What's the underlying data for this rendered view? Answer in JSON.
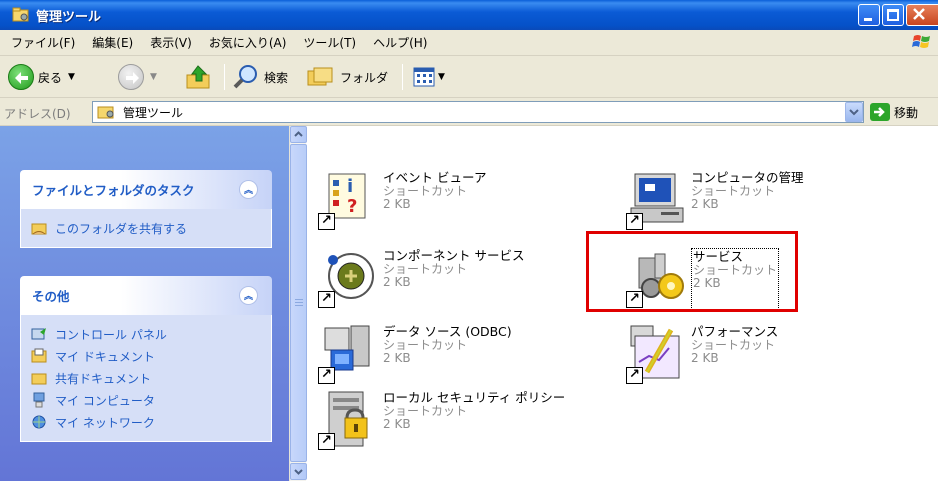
{
  "window": {
    "title": "管理ツール"
  },
  "menu": [
    "ファイル(F)",
    "編集(E)",
    "表示(V)",
    "お気に入り(A)",
    "ツール(T)",
    "ヘルプ(H)"
  ],
  "toolbar": {
    "back_label": "戻る",
    "search_label": "検索",
    "folders_label": "フォルダ"
  },
  "address": {
    "label": "アドレス(D)",
    "value": "管理ツール",
    "go_label": "移動"
  },
  "left_panel": {
    "tasks": {
      "title": "ファイルとフォルダのタスク",
      "items": [
        "このフォルダを共有する"
      ]
    },
    "other": {
      "title": "その他",
      "items": [
        "コントロール パネル",
        "マイ ドキュメント",
        "共有ドキュメント",
        "マイ コンピュータ",
        "マイ ネットワーク"
      ]
    }
  },
  "files": [
    {
      "name": "イベント ビューア",
      "type": "ショートカット",
      "size": "2 KB",
      "icon": "event-viewer-icon"
    },
    {
      "name": "コンピュータの管理",
      "type": "ショートカット",
      "size": "2 KB",
      "icon": "computer-management-icon"
    },
    {
      "name": "コンポーネント サービス",
      "type": "ショートカット",
      "size": "2 KB",
      "icon": "component-services-icon"
    },
    {
      "name": "サービス",
      "type": "ショートカット",
      "size": "2 KB",
      "icon": "services-icon"
    },
    {
      "name": "データ ソース (ODBC)",
      "type": "ショートカット",
      "size": "2 KB",
      "icon": "odbc-icon"
    },
    {
      "name": "パフォーマンス",
      "type": "ショートカット",
      "size": "2 KB",
      "icon": "performance-icon"
    },
    {
      "name": "ローカル セキュリティ ポリシー",
      "type": "ショートカット",
      "size": "2 KB",
      "icon": "security-policy-icon"
    }
  ],
  "colors": {
    "title_bar": "#0b5bd6",
    "task_link": "#215dc6",
    "highlight": "#e00000"
  }
}
